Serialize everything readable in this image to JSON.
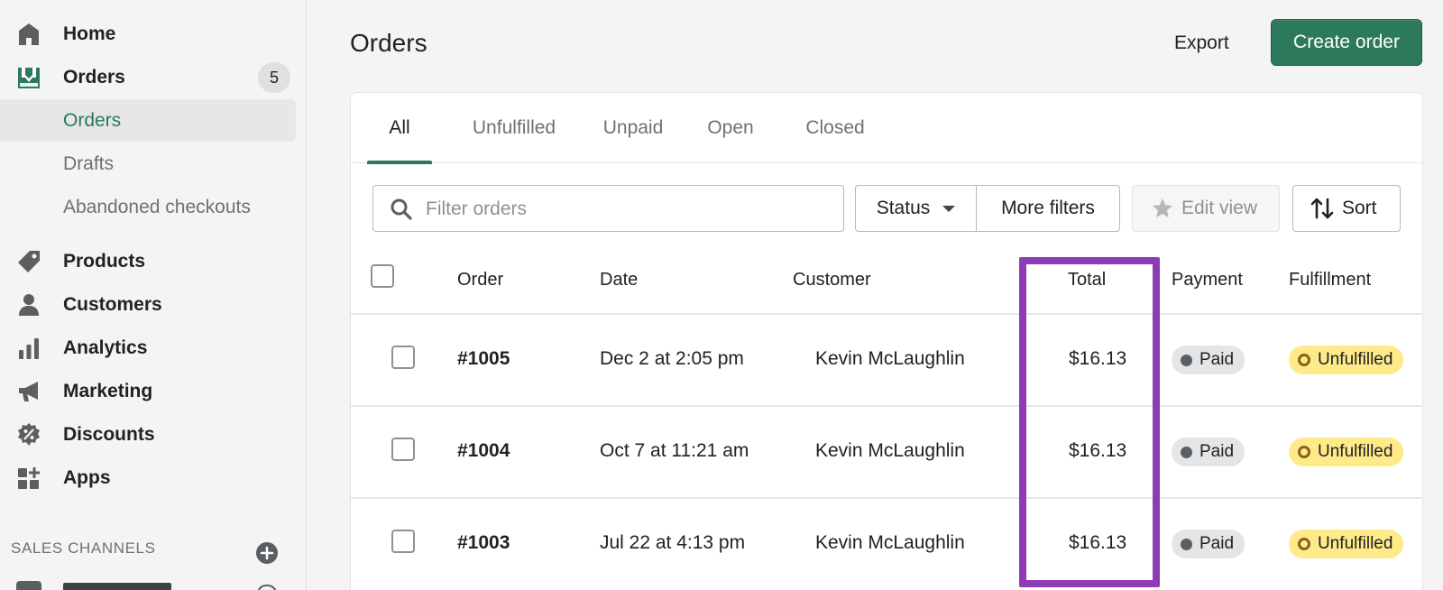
{
  "sidebar": {
    "home": "Home",
    "orders": "Orders",
    "orders_badge": "5",
    "sub_orders": "Orders",
    "sub_drafts": "Drafts",
    "sub_abandoned": "Abandoned checkouts",
    "products": "Products",
    "customers": "Customers",
    "analytics": "Analytics",
    "marketing": "Marketing",
    "discounts": "Discounts",
    "apps": "Apps",
    "sales_channels": "SALES CHANNELS"
  },
  "header": {
    "title": "Orders",
    "export_label": "Export",
    "create_label": "Create order"
  },
  "tabs": [
    "All",
    "Unfulfilled",
    "Unpaid",
    "Open",
    "Closed"
  ],
  "toolbar": {
    "filter_placeholder": "Filter orders",
    "status_label": "Status",
    "more_filters_label": "More filters",
    "edit_view_label": "Edit view",
    "sort_label": "Sort"
  },
  "table": {
    "columns": [
      "Order",
      "Date",
      "Customer",
      "Total",
      "Payment",
      "Fulfillment"
    ],
    "rows": [
      {
        "order": "#1005",
        "date": "Dec 2 at 2:05 pm",
        "customer": "Kevin McLaughlin",
        "total": "$16.13",
        "payment": "Paid",
        "fulfillment": "Unfulfilled"
      },
      {
        "order": "#1004",
        "date": "Oct 7 at 11:21 am",
        "customer": "Kevin McLaughlin",
        "total": "$16.13",
        "payment": "Paid",
        "fulfillment": "Unfulfilled"
      },
      {
        "order": "#1003",
        "date": "Jul 22 at 4:13 pm",
        "customer": "Kevin McLaughlin",
        "total": "$16.13",
        "payment": "Paid",
        "fulfillment": "Unfulfilled"
      }
    ]
  },
  "colors": {
    "accent": "#2c7a5b",
    "highlight": "#8e3bb5",
    "unfulfilled_badge": "#ffea8a",
    "paid_badge": "#e4e5e7"
  },
  "icons": {
    "home": "home-icon",
    "orders": "orders-inbox-icon",
    "products": "tag-icon",
    "customers": "person-icon",
    "analytics": "bar-chart-icon",
    "marketing": "megaphone-icon",
    "discounts": "discount-badge-icon",
    "apps": "apps-grid-icon",
    "search": "search-icon",
    "star": "star-icon",
    "sort": "sort-arrows-icon",
    "add": "plus-circle-icon"
  }
}
